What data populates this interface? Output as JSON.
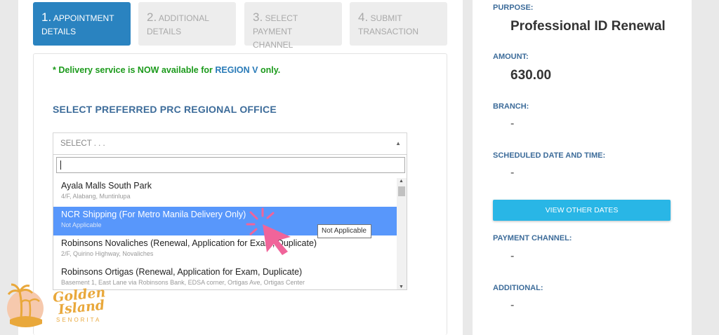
{
  "steps": [
    {
      "num": "1.",
      "label": "Appointment Details",
      "active": true
    },
    {
      "num": "2.",
      "label": "Additional Details",
      "active": false
    },
    {
      "num": "3.",
      "label": "Select Payment Channel",
      "active": false
    },
    {
      "num": "4.",
      "label": "Submit Transaction",
      "active": false
    }
  ],
  "notice": {
    "prefix": "* Delivery service is NOW available for ",
    "region": "REGION V",
    "suffix": " only."
  },
  "section_title": "SELECT PREFERRED PRC REGIONAL OFFICE",
  "select": {
    "placeholder": "SELECT . . .",
    "search_value": ""
  },
  "options": [
    {
      "name": "Ayala Malls South Park",
      "address": "4/F, Alabang, Muntinlupa"
    },
    {
      "name": "NCR Shipping (For Metro Manila Delivery Only)",
      "address": "Not Applicable"
    },
    {
      "name": "Robinsons Novaliches (Renewal, Application for Exam, Duplicate)",
      "address": "2/F, Quirino Highway, Novaliches"
    },
    {
      "name": "Robinsons Ortigas (Renewal, Application for Exam, Duplicate)",
      "address": "Basement 1, East Lane via Robinsons Bank, EDSA corner, Ortigas Ave, Ortigas Center"
    }
  ],
  "highlighted_option_index": 1,
  "tooltip": "Not Applicable",
  "summary": {
    "purpose_label": "PURPOSE:",
    "purpose_value": "Professional ID Renewal",
    "amount_label": "AMOUNT:",
    "amount_value": "630.00",
    "branch_label": "BRANCH:",
    "branch_value": "-",
    "schedule_label": "SCHEDULED DATE AND TIME:",
    "schedule_value": "-",
    "view_dates_button": "View Other Dates",
    "payment_label": "PAYMENT CHANNEL:",
    "payment_value": "-",
    "additional_label": "ADDITIONAL:",
    "additional_value": "-"
  },
  "watermark": {
    "line1": "Golden",
    "line2": "Island",
    "line3": "SENORITA"
  },
  "colors": {
    "primary": "#2a83c0",
    "highlight": "#5897fb",
    "notice_green": "#1b9a1b",
    "button_cyan": "#29b6e6",
    "cursor_pink": "#f0649a"
  }
}
